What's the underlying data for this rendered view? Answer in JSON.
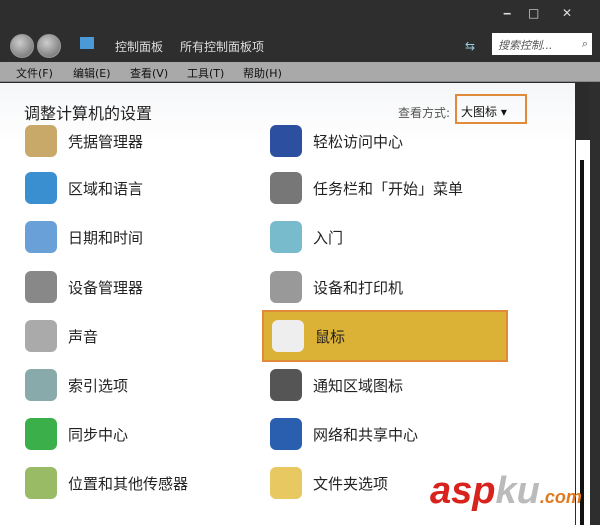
{
  "window": {
    "minimize": "‒",
    "maximize": "□",
    "close": "✕"
  },
  "address": {
    "crumbs": [
      "控制面板",
      "所有控制面板项"
    ],
    "search_placeholder": "搜索控制...",
    "search_icon": "⌕"
  },
  "menu": [
    "文件(F)",
    "编辑(E)",
    "查看(V)",
    "工具(T)",
    "帮助(H)"
  ],
  "heading": "调整计算机的设置",
  "view": {
    "label": "查看方式:",
    "value": "大图标 ▾"
  },
  "items_left": [
    {
      "label": "凭据管理器",
      "color": "#c9a96a"
    },
    {
      "label": "区域和语言",
      "color": "#3a8fd0"
    },
    {
      "label": "日期和时间",
      "color": "#6aa0d8"
    },
    {
      "label": "设备管理器",
      "color": "#888"
    },
    {
      "label": "声音",
      "color": "#aaa"
    },
    {
      "label": "索引选项",
      "color": "#8aa"
    },
    {
      "label": "同步中心",
      "color": "#3bb04a"
    },
    {
      "label": "位置和其他传感器",
      "color": "#9b6"
    }
  ],
  "items_right": [
    {
      "label": "轻松访问中心",
      "color": "#2c4fa0"
    },
    {
      "label": "任务栏和「开始」菜单",
      "color": "#777"
    },
    {
      "label": "入门",
      "color": "#7bc"
    },
    {
      "label": "设备和打印机",
      "color": "#999"
    },
    {
      "label": "鼠标",
      "color": "#eee",
      "selected": true
    },
    {
      "label": "通知区域图标",
      "color": "#555"
    },
    {
      "label": "网络和共享中心",
      "color": "#2a5fb0"
    },
    {
      "label": "文件夹选项",
      "color": "#e8c860"
    }
  ],
  "watermark": "aspku.com"
}
